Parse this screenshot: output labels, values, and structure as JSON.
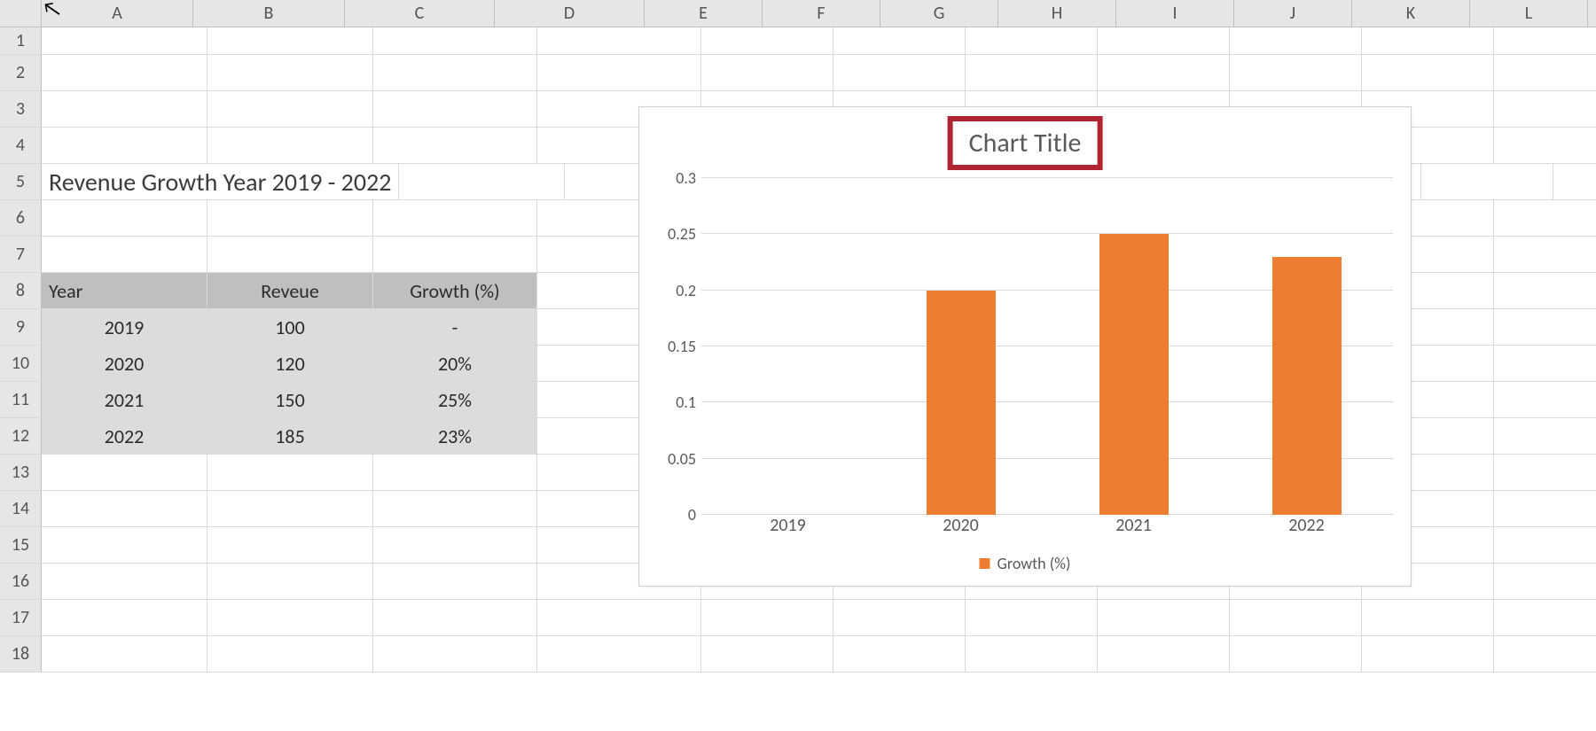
{
  "columns": [
    "A",
    "B",
    "C",
    "D",
    "E",
    "F",
    "G",
    "H",
    "I",
    "J",
    "K",
    "L"
  ],
  "row_count": 18,
  "title_cell": "Revenue Growth Year 2019 - 2022",
  "table": {
    "headers": {
      "year": "Year",
      "revenue": "Reveue",
      "growth": "Growth (%)"
    },
    "rows": [
      {
        "year": "2019",
        "revenue": "100",
        "growth": "-"
      },
      {
        "year": "2020",
        "revenue": "120",
        "growth": "20%"
      },
      {
        "year": "2021",
        "revenue": "150",
        "growth": "25%"
      },
      {
        "year": "2022",
        "revenue": "185",
        "growth": "23%"
      }
    ]
  },
  "chart_title_placeholder": "Chart Title",
  "chart_legend_label": "Growth (%)",
  "chart_data": {
    "type": "bar",
    "title": "Chart Title",
    "categories": [
      "2019",
      "2020",
      "2021",
      "2022"
    ],
    "series": [
      {
        "name": "Growth (%)",
        "values": [
          0,
          0.2,
          0.25,
          0.23
        ]
      }
    ],
    "xlabel": "",
    "ylabel": "",
    "ylim": [
      0,
      0.3
    ],
    "y_ticks": [
      "0",
      "0.05",
      "0.1",
      "0.15",
      "0.2",
      "0.25",
      "0.3"
    ]
  }
}
